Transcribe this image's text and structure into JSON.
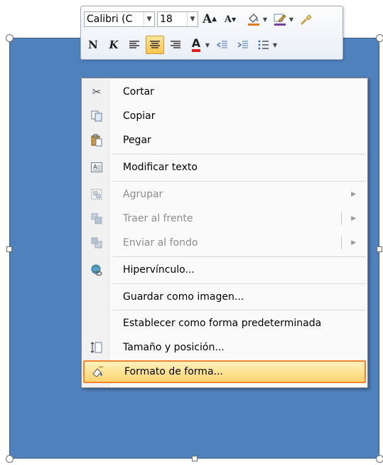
{
  "mini_toolbar": {
    "font_name": "Calibri (C",
    "font_size": "18",
    "grow_font_label": "A",
    "shrink_font_label": "A",
    "bold_label": "N",
    "italic_label": "K",
    "font_color_label": "A"
  },
  "context_menu": {
    "items": [
      {
        "label": "Cortar",
        "icon": "scissors-icon",
        "enabled": true
      },
      {
        "label": "Copiar",
        "icon": "copy-icon",
        "enabled": true
      },
      {
        "label": "Pegar",
        "icon": "paste-icon",
        "enabled": true
      },
      {
        "label": "Modificar texto",
        "icon": "edit-text-icon",
        "enabled": true
      },
      {
        "label": "Agrupar",
        "icon": "group-icon",
        "enabled": false,
        "submenu": true
      },
      {
        "label": "Traer al frente",
        "icon": "bring-front-icon",
        "enabled": false,
        "submenu": true
      },
      {
        "label": "Enviar al fondo",
        "icon": "send-back-icon",
        "enabled": false,
        "submenu": true
      },
      {
        "label": "Hipervínculo...",
        "icon": "hyperlink-icon",
        "enabled": true
      },
      {
        "label": "Guardar como imagen...",
        "icon": "",
        "enabled": true
      },
      {
        "label": "Establecer como forma predeterminada",
        "icon": "",
        "enabled": true
      },
      {
        "label": "Tamaño y posición...",
        "icon": "size-position-icon",
        "enabled": true
      },
      {
        "label": "Formato de forma...",
        "icon": "format-shape-icon",
        "enabled": true,
        "highlighted": true
      }
    ]
  },
  "colors": {
    "shape_fill": "#4f81bd",
    "highlight_border": "#f2842b",
    "font_color": "#e02020"
  }
}
